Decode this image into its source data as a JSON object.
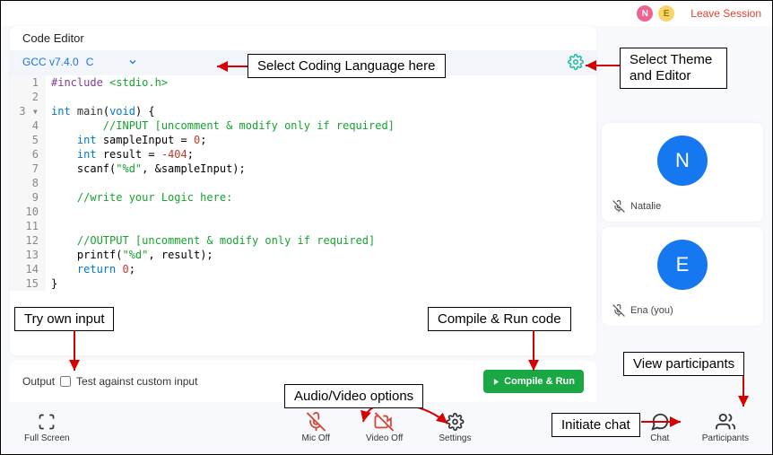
{
  "topbar": {
    "avatar1_letter": "N",
    "avatar2_letter": "E",
    "leave_label": "Leave Session"
  },
  "editor": {
    "title": "Code Editor",
    "compiler_label": "GCC v7.4.0",
    "language": "C",
    "gear_name": "settings-icon",
    "lines": [
      {
        "n": "1",
        "html": "<span class='tok-pp'>#include</span> <span class='tok-str'>&lt;stdio.h&gt;</span>"
      },
      {
        "n": "2",
        "html": ""
      },
      {
        "n": "3",
        "fold": true,
        "html": "<span class='tok-kw'>int</span> <span class='tok-id'>main</span>(<span class='tok-kw'>void</span>) {"
      },
      {
        "n": "4",
        "html": "        <span class='tok-cmt'>//INPUT [uncomment &amp; modify only if required]</span>"
      },
      {
        "n": "5",
        "html": "    <span class='tok-kw'>int</span> sampleInput = <span class='tok-num'>0</span>;"
      },
      {
        "n": "6",
        "html": "    <span class='tok-kw'>int</span> result = <span class='tok-num'>-404</span>;"
      },
      {
        "n": "7",
        "html": "    scanf(<span class='tok-str'>\"%d\"</span>, &amp;sampleInput);"
      },
      {
        "n": "8",
        "html": ""
      },
      {
        "n": "9",
        "html": "    <span class='tok-cmt'>//write your Logic here:</span>"
      },
      {
        "n": "10",
        "html": ""
      },
      {
        "n": "11",
        "html": ""
      },
      {
        "n": "12",
        "html": "    <span class='tok-cmt'>//OUTPUT [uncomment &amp; modify only if required]</span>"
      },
      {
        "n": "13",
        "html": "    printf(<span class='tok-str'>\"%d\"</span>, result);"
      },
      {
        "n": "14",
        "html": "    <span class='tok-kw'>return</span> <span class='tok-num'>0</span>;"
      },
      {
        "n": "15",
        "html": "}"
      }
    ]
  },
  "output": {
    "label": "Output",
    "checkbox_label": "Test against custom input",
    "compile_label": "Compile & Run"
  },
  "participants": [
    {
      "letter": "N",
      "name": "Natalie"
    },
    {
      "letter": "E",
      "name": "Ena (you)"
    }
  ],
  "bottombar": {
    "fullscreen": "Full Screen",
    "mic": "Mic Off",
    "video": "Video Off",
    "settings": "Settings",
    "chat": "Chat",
    "participants": "Participants"
  },
  "annotations": {
    "lang": "Select Coding Language here",
    "theme": "Select Theme and Editor",
    "input": "Try own input",
    "compile": "Compile & Run code",
    "av": "Audio/Video options",
    "chat": "Initiate chat",
    "participants": "View participants"
  }
}
